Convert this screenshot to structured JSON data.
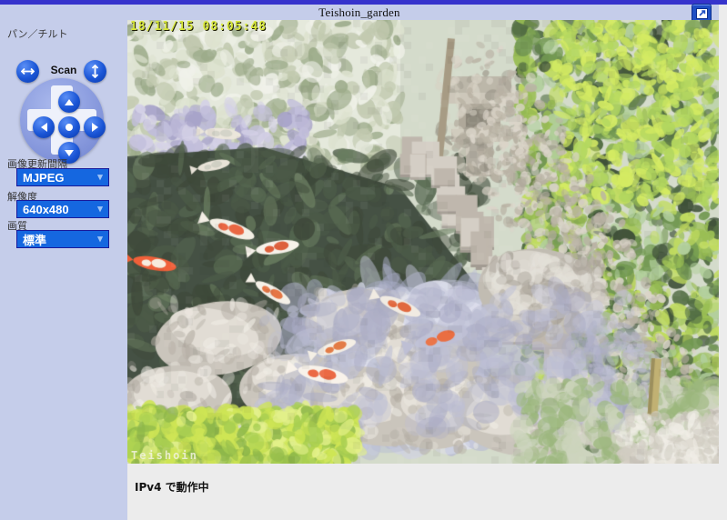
{
  "window": {
    "title": "Teishoin_garden",
    "popup_button_icon": "popup-window-icon"
  },
  "sidebar": {
    "pantilt": {
      "label": "パン／チルト",
      "scan_label": "Scan",
      "scan_horizontal_icon": "horizontal-scan-icon",
      "scan_vertical_icon": "vertical-scan-icon",
      "buttons": {
        "up": "tilt-up",
        "down": "tilt-down",
        "left": "pan-left",
        "right": "pan-right",
        "home": "home-position"
      }
    },
    "controls": [
      {
        "label": "画像更新間隔",
        "value": "MJPEG"
      },
      {
        "label": "解像度",
        "value": "640x480"
      },
      {
        "label": "画質",
        "value": "標準"
      }
    ]
  },
  "video": {
    "timestamp": "18/11/15 08:05:48",
    "watermark": "Teishoin"
  },
  "status": {
    "text": "IPv4 で動作中"
  },
  "colors": {
    "title_bar": "#c5cdea",
    "top_strip": "#3633cc",
    "page_background": "#ececec",
    "select_blue": "#1567e0",
    "button_blue": "#1a55d6"
  }
}
